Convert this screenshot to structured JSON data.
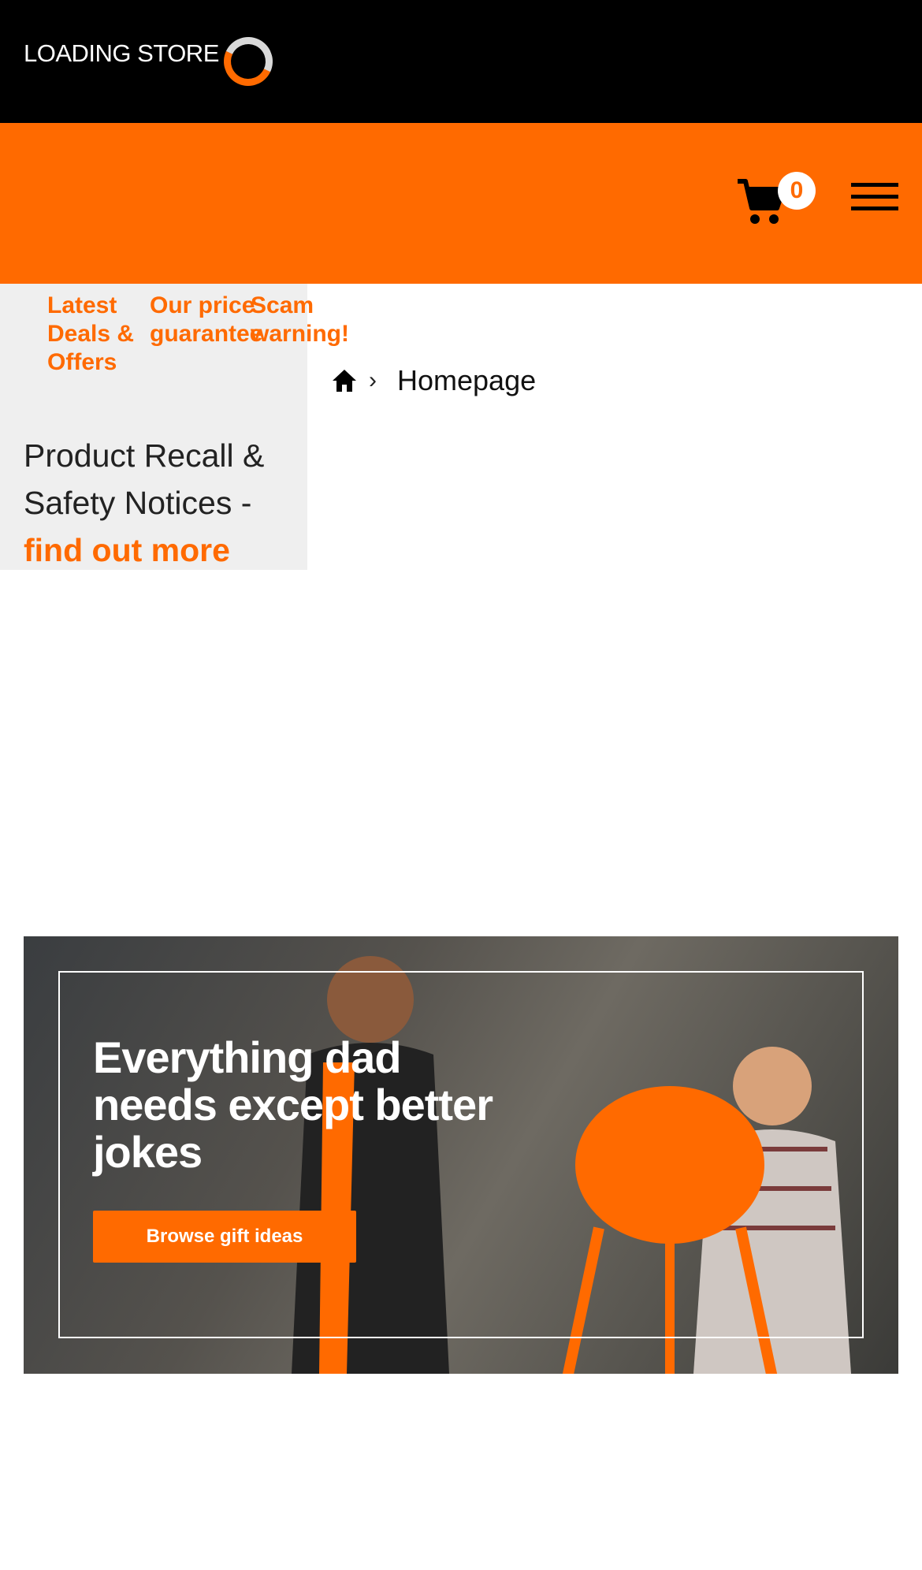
{
  "store_bar": {
    "label": "LOADING STORE"
  },
  "header": {
    "cart_count": "0"
  },
  "promo_links": [
    {
      "label": "Latest Deals & Offers"
    },
    {
      "label": "Our price guarantee"
    },
    {
      "label": "Scam warning!"
    }
  ],
  "recall": {
    "text": "Product Recall & Safety Notices -",
    "link": "find out more"
  },
  "breadcrumb": {
    "separator": "›",
    "current": "Homepage"
  },
  "banner": {
    "title": "Everything dad needs except better jokes",
    "button": "Browse gift ideas"
  },
  "colors": {
    "brand_orange": "#ff6a00",
    "black": "#000000",
    "panel_grey": "#efefef"
  },
  "icons": [
    "loading-spinner-icon",
    "cart-icon",
    "hamburger-menu-icon",
    "home-icon"
  ]
}
